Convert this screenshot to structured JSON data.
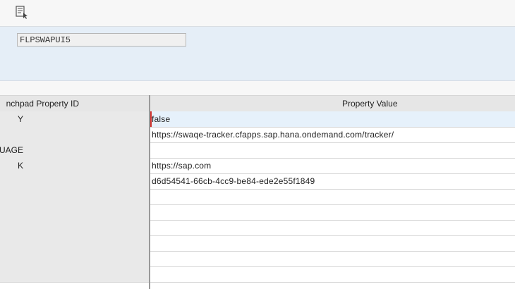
{
  "toolbar": {
    "items": [
      {
        "icon": "variant-selection-icon"
      }
    ]
  },
  "header": {
    "variant_value": "FLPSWAPUI5"
  },
  "table": {
    "columns": [
      "nchpad Property ID",
      "Property Value"
    ],
    "rows": [
      {
        "id": "Y",
        "value": "false"
      },
      {
        "id": "",
        "value": "https://swaqe-tracker.cfapps.sap.hana.ondemand.com/tracker/"
      },
      {
        "id": "SUAGE",
        "value": ""
      },
      {
        "id": "K",
        "value": "https://sap.com"
      },
      {
        "id": "",
        "value": "d6d54541-66cb-4cc9-be84-ede2e55f1849"
      },
      {
        "id": "",
        "value": ""
      },
      {
        "id": "",
        "value": ""
      },
      {
        "id": "",
        "value": ""
      },
      {
        "id": "",
        "value": ""
      },
      {
        "id": "",
        "value": ""
      },
      {
        "id": "",
        "value": ""
      }
    ]
  }
}
